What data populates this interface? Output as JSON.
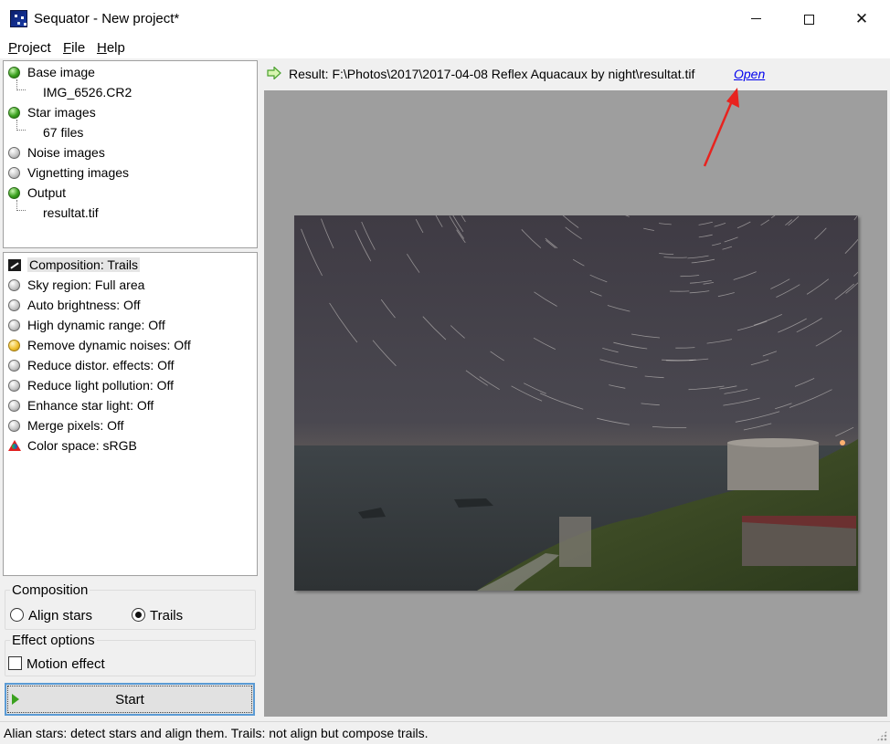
{
  "window": {
    "title": "Sequator - New project*"
  },
  "menu": [
    "Project",
    "File",
    "Help"
  ],
  "inputs_tree": {
    "base_image": "Base image",
    "base_image_file": "IMG_6526.CR2",
    "star_images": "Star images",
    "star_images_count": "67 files",
    "noise_images": "Noise images",
    "vignetting_images": "Vignetting images",
    "output": "Output",
    "output_file": "resultat.tif"
  },
  "options": [
    {
      "label": "Composition: Trails",
      "icon": "composition-icon"
    },
    {
      "label": "Sky region: Full area",
      "icon": "gray-dot"
    },
    {
      "label": "Auto brightness: Off",
      "icon": "gray-dot"
    },
    {
      "label": "High dynamic range: Off",
      "icon": "gray-dot"
    },
    {
      "label": "Remove dynamic noises: Off",
      "icon": "yellow-dot"
    },
    {
      "label": "Reduce distor. effects: Off",
      "icon": "gray-dot"
    },
    {
      "label": "Reduce light pollution: Off",
      "icon": "gray-dot"
    },
    {
      "label": "Enhance star light: Off",
      "icon": "gray-dot"
    },
    {
      "label": "Merge pixels: Off",
      "icon": "gray-dot"
    },
    {
      "label": "Color space: sRGB",
      "icon": "color-icon"
    }
  ],
  "composition_group": {
    "title": "Composition",
    "align_stars": "Align stars",
    "trails": "Trails",
    "selected": "Trails"
  },
  "effect_group": {
    "title": "Effect options",
    "motion_effect": "Motion effect",
    "motion_effect_checked": false
  },
  "start_button": "Start",
  "result": {
    "text": "Result: F:\\Photos\\2017\\2017-04-08 Reflex Aquacaux by night\\resultat.tif",
    "link": "Open"
  },
  "status": "Alian stars: detect stars and align them. Trails: not align but compose trails.",
  "colors": {
    "accent_blue": "#5b9bd5",
    "link": "#0000ee",
    "preview_bg": "#9e9e9e",
    "annotation_red": "#e8231f"
  }
}
